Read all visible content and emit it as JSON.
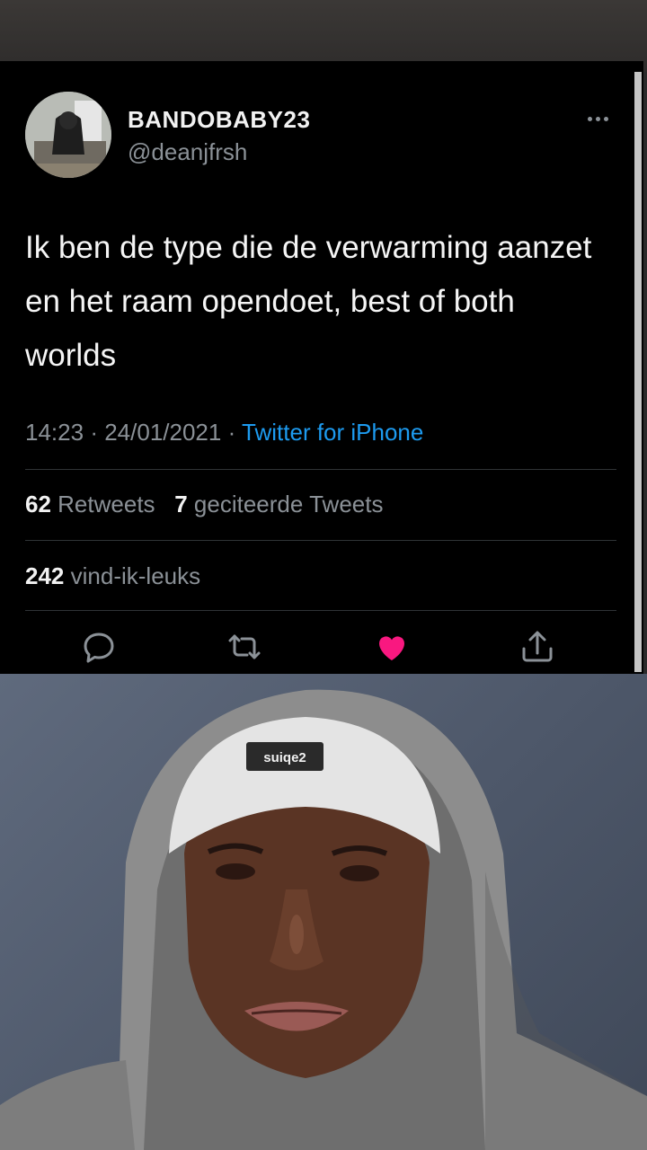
{
  "tweet": {
    "display_name": "BANDOBABY23",
    "handle": "@deanjfrsh",
    "text": "Ik ben de type die de verwarming aanzet en het raam opendoet, best of both worlds",
    "time": "14:23",
    "date": "24/01/2021",
    "separator": "·",
    "source": "Twitter for iPhone",
    "retweets_count": "62",
    "retweets_label": "Retweets",
    "quotes_count": "7",
    "quotes_label": "geciteerde Tweets",
    "likes_count": "242",
    "likes_label": "vind-ik-leuks"
  },
  "icons": {
    "more": "more-horizontal-icon",
    "reply": "reply-icon",
    "retweet": "retweet-icon",
    "like": "heart-filled-icon",
    "share": "share-icon"
  },
  "colors": {
    "background": "#000000",
    "link": "#1d9bf0",
    "secondary_text": "#8b9197",
    "like": "#f91880"
  },
  "photo": {
    "beanie_label": "suiqe2"
  }
}
